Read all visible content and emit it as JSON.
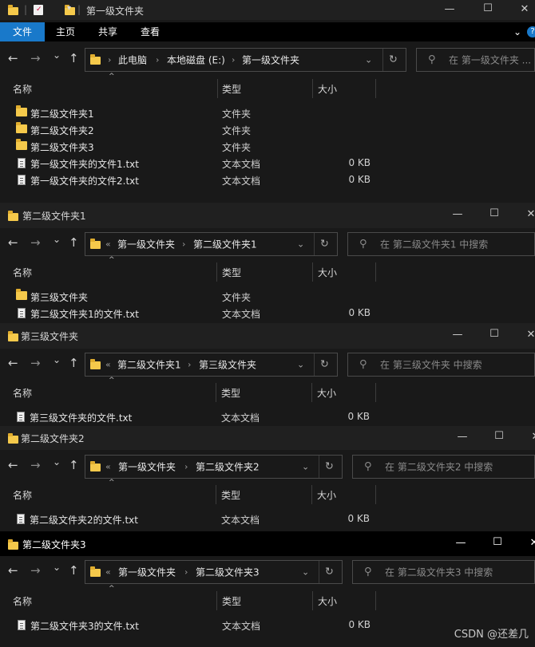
{
  "w1": {
    "title": "第一级文件夹",
    "ribbon": [
      "文件",
      "主页",
      "共享",
      "查看"
    ],
    "path": [
      "此电脑",
      "本地磁盘 (E:)",
      "第一级文件夹"
    ],
    "search_placeholder": "在 第一级文件夹 ...",
    "columns": [
      "名称",
      "类型",
      "大小"
    ],
    "rows": [
      {
        "name": "第二级文件夹1",
        "type": "文件夹",
        "size": ""
      },
      {
        "name": "第二级文件夹2",
        "type": "文件夹",
        "size": ""
      },
      {
        "name": "第二级文件夹3",
        "type": "文件夹",
        "size": ""
      },
      {
        "name": "第一级文件夹的文件1.txt",
        "type": "文本文档",
        "size": "0 KB"
      },
      {
        "name": "第一级文件夹的文件2.txt",
        "type": "文本文档",
        "size": "0 KB"
      }
    ]
  },
  "w2": {
    "title": "第二级文件夹1",
    "path": [
      "第一级文件夹",
      "第二级文件夹1"
    ],
    "search_placeholder": "在 第二级文件夹1 中搜索",
    "columns": [
      "名称",
      "类型",
      "大小"
    ],
    "rows": [
      {
        "name": "第三级文件夹",
        "type": "文件夹",
        "size": ""
      },
      {
        "name": "第二级文件夹1的文件.txt",
        "type": "文本文档",
        "size": "0 KB"
      }
    ]
  },
  "w3": {
    "title": "第三级文件夹",
    "path": [
      "第二级文件夹1",
      "第三级文件夹"
    ],
    "search_placeholder": "在 第三级文件夹 中搜索",
    "columns": [
      "名称",
      "类型",
      "大小"
    ],
    "rows": [
      {
        "name": "第三级文件夹的文件.txt",
        "type": "文本文档",
        "size": "0 KB"
      }
    ]
  },
  "w4": {
    "title": "第二级文件夹2",
    "path": [
      "第一级文件夹",
      "第二级文件夹2"
    ],
    "search_placeholder": "在 第二级文件夹2 中搜索",
    "columns": [
      "名称",
      "类型",
      "大小"
    ],
    "rows": [
      {
        "name": "第二级文件夹2的文件.txt",
        "type": "文本文档",
        "size": "0 KB"
      }
    ]
  },
  "w5": {
    "title": "第二级文件夹3",
    "path": [
      "第一级文件夹",
      "第二级文件夹3"
    ],
    "search_placeholder": "在 第二级文件夹3 中搜索",
    "columns": [
      "名称",
      "类型",
      "大小"
    ],
    "rows": [
      {
        "name": "第二级文件夹3的文件.txt",
        "type": "文本文档",
        "size": "0 KB"
      }
    ]
  },
  "glyphs": {
    "back": "←",
    "forward": "→",
    "recent": "⌄",
    "up": "↑",
    "minimize": "—",
    "maximize": "☐",
    "close": "✕",
    "sep": "›",
    "overflow": "«",
    "dropdown": "⌄",
    "refresh": "↻",
    "search": "⚲",
    "sort": "^",
    "expand": "⌄",
    "help": "?"
  },
  "watermark": "CSDN @还差几"
}
